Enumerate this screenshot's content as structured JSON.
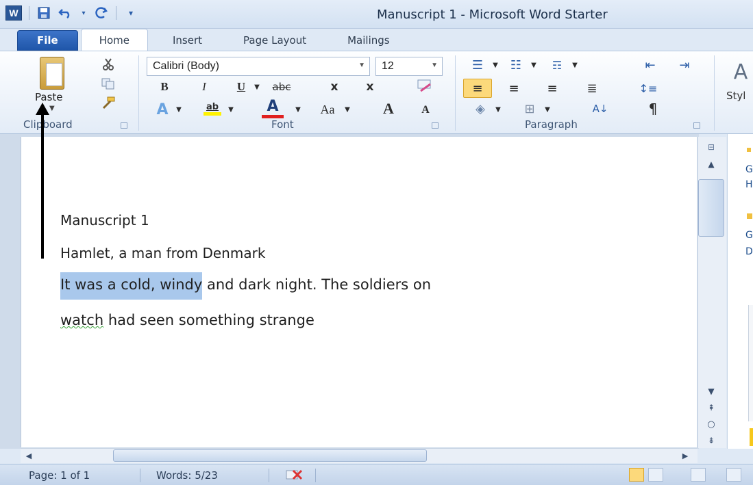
{
  "window": {
    "title": "Manuscript 1  -  Microsoft Word Starter",
    "logo_letter": "W"
  },
  "quick_access": {
    "save_icon": "save-icon",
    "undo_icon": "undo-icon",
    "redo_icon": "redo-icon",
    "customize_icon": "customize-qat-icon"
  },
  "tabs": [
    "File",
    "Home",
    "Insert",
    "Page Layout",
    "Mailings"
  ],
  "ribbon": {
    "clipboard": {
      "label": "Clipboard",
      "paste_label": "Paste"
    },
    "font": {
      "label": "Font",
      "font_name": "Calibri (Body)",
      "font_size": "12",
      "bold": "B",
      "italic": "I",
      "underline": "U",
      "strikethrough": "abc",
      "subscript": "x",
      "superscript": "x",
      "highlight": "ab",
      "font_color": "A",
      "change_case": "Aa",
      "grow_font": "A",
      "shrink_font": "A"
    },
    "paragraph": {
      "label": "Paragraph",
      "pilcrow": "¶"
    },
    "styles": {
      "label_partial": "Styl",
      "sample": "A"
    }
  },
  "document": {
    "title_line": "Manuscript 1",
    "subtitle_line": "Hamlet, a man from Denmark",
    "para_line1_selected": "It was a cold, windy",
    "para_line1_rest": " and dark night. The soldiers on",
    "para_line2_word": "watch",
    "para_line2_rest": " had seen something strange"
  },
  "status": {
    "page": "Page: 1 of 1",
    "words": "Words: 5/23"
  },
  "side_pane": {
    "letters": [
      "G",
      "H",
      "G",
      "D"
    ]
  },
  "colors": {
    "file_tab": "#2b5797",
    "selection": "#a9c8ec",
    "active_button": "#fcd97b"
  }
}
